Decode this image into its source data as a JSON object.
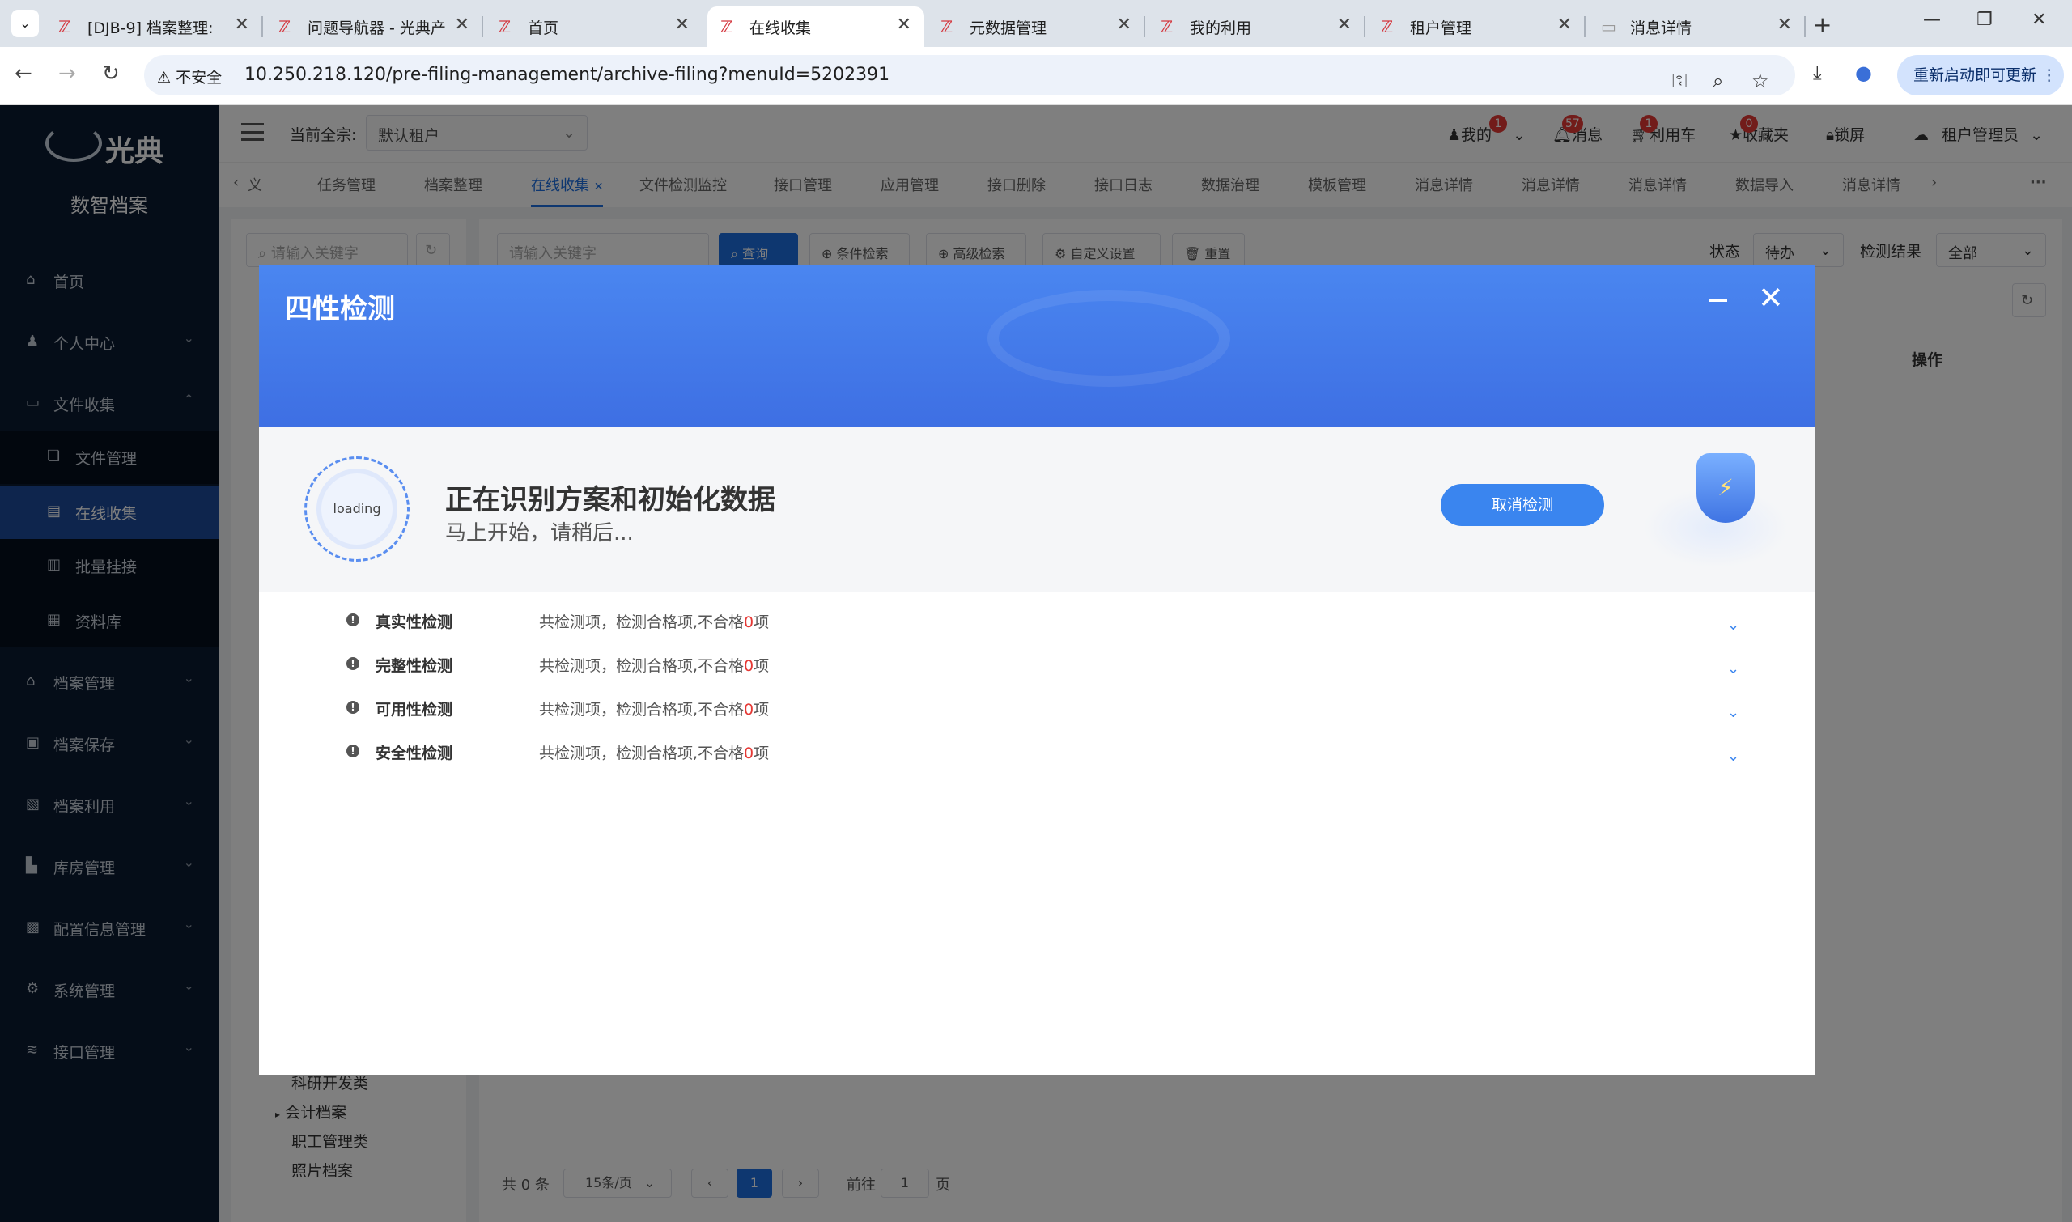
{
  "browser": {
    "tabs": [
      {
        "title": "[DJB-9] 档案整理: ",
        "active": false
      },
      {
        "title": "问题导航器 - 光典产",
        "active": false
      },
      {
        "title": "首页",
        "active": false
      },
      {
        "title": "在线收集",
        "active": true
      },
      {
        "title": "元数据管理",
        "active": false
      },
      {
        "title": "我的利用",
        "active": false
      },
      {
        "title": "租户管理",
        "active": false
      },
      {
        "title": "消息详情",
        "active": false
      }
    ],
    "insecure_label": "不安全",
    "url": "10.250.218.120/pre-filing-management/archive-filing?menuId=5202391",
    "update_button": "重新启动即可更新"
  },
  "sidebar": {
    "logo_text": "光典",
    "subtitle": "数智档案",
    "items": [
      {
        "label": "首页",
        "icon": "home-icon",
        "chevron": false
      },
      {
        "label": "个人中心",
        "icon": "user-icon",
        "chevron": true
      },
      {
        "label": "文件收集",
        "icon": "briefcase-icon",
        "chevron": true,
        "expanded": true
      },
      {
        "label": "文件管理",
        "icon": "file-copy-icon",
        "sub": true
      },
      {
        "label": "在线收集",
        "icon": "document-icon",
        "sub": true,
        "selected": true
      },
      {
        "label": "批量挂接",
        "icon": "chart-icon",
        "sub": true
      },
      {
        "label": "资料库",
        "icon": "calendar-icon",
        "sub": true
      },
      {
        "label": "档案管理",
        "icon": "bank-icon",
        "chevron": true
      },
      {
        "label": "档案保存",
        "icon": "storage-icon",
        "chevron": true
      },
      {
        "label": "档案利用",
        "icon": "clipboard-icon",
        "chevron": true
      },
      {
        "label": "库房管理",
        "icon": "building-icon",
        "chevron": true
      },
      {
        "label": "配置信息管理",
        "icon": "lock-icon",
        "chevron": true
      },
      {
        "label": "系统管理",
        "icon": "gear-icon",
        "chevron": true
      },
      {
        "label": "接口管理",
        "icon": "database-icon",
        "chevron": true
      }
    ]
  },
  "header": {
    "current_label": "当前全宗:",
    "tenant_value": "默认租户",
    "mine": {
      "label": "我的",
      "badge": "1"
    },
    "messages": {
      "label": "消息",
      "badge": "57"
    },
    "cart": {
      "label": "利用车",
      "badge": "1"
    },
    "favorites": {
      "label": "收藏夹",
      "badge": "0"
    },
    "lock": "锁屏",
    "user": "租户管理员"
  },
  "tags": [
    "义",
    "任务管理",
    "档案整理",
    "在线收集",
    "文件检测监控",
    "接口管理",
    "应用管理",
    "接口删除",
    "接口日志",
    "数据治理",
    "模板管理",
    "消息详情",
    "消息详情",
    "消息详情",
    "数据导入",
    "消息详情"
  ],
  "content": {
    "left_search_placeholder": "请输入关键字",
    "right_search_placeholder": "请输入关键字",
    "query_btn": "查询",
    "cond_btn": "条件检索",
    "adv_btn": "高级检索",
    "custom_btn": "自定义设置",
    "reset_btn": "重置",
    "status_label": "状态",
    "status_value": "待办",
    "result_label": "检测结果",
    "result_value": "全部",
    "op_col": "操作",
    "tree": [
      "科研开发类",
      "会计档案",
      "职工管理类",
      "照片档案"
    ],
    "pager": {
      "total": "共 0 条",
      "size": "15条/页",
      "page": "1",
      "goto": "前往",
      "goto_value": "1",
      "unit": "页"
    }
  },
  "modal": {
    "title": "四性检测",
    "loading": "loading",
    "status_title": "正在识别方案和初始化数据",
    "status_sub": "马上开始，请稍后...",
    "cancel_button": "取消检测",
    "checks": [
      {
        "name": "真实性检测",
        "prefix": "共检测项，检测合格项,不合格",
        "count": "0",
        "suffix": "项"
      },
      {
        "name": "完整性检测",
        "prefix": "共检测项，检测合格项,不合格",
        "count": "0",
        "suffix": "项"
      },
      {
        "name": "可用性检测",
        "prefix": "共检测项，检测合格项,不合格",
        "count": "0",
        "suffix": "项"
      },
      {
        "name": "安全性检测",
        "prefix": "共检测项，检测合格项,不合格",
        "count": "0",
        "suffix": "项"
      }
    ]
  },
  "colors": {
    "accent": "#1d6fe0",
    "sidebar_bg": "#0a1a31",
    "modal_header": "#4a86f0",
    "fail_count": "#e53935"
  }
}
